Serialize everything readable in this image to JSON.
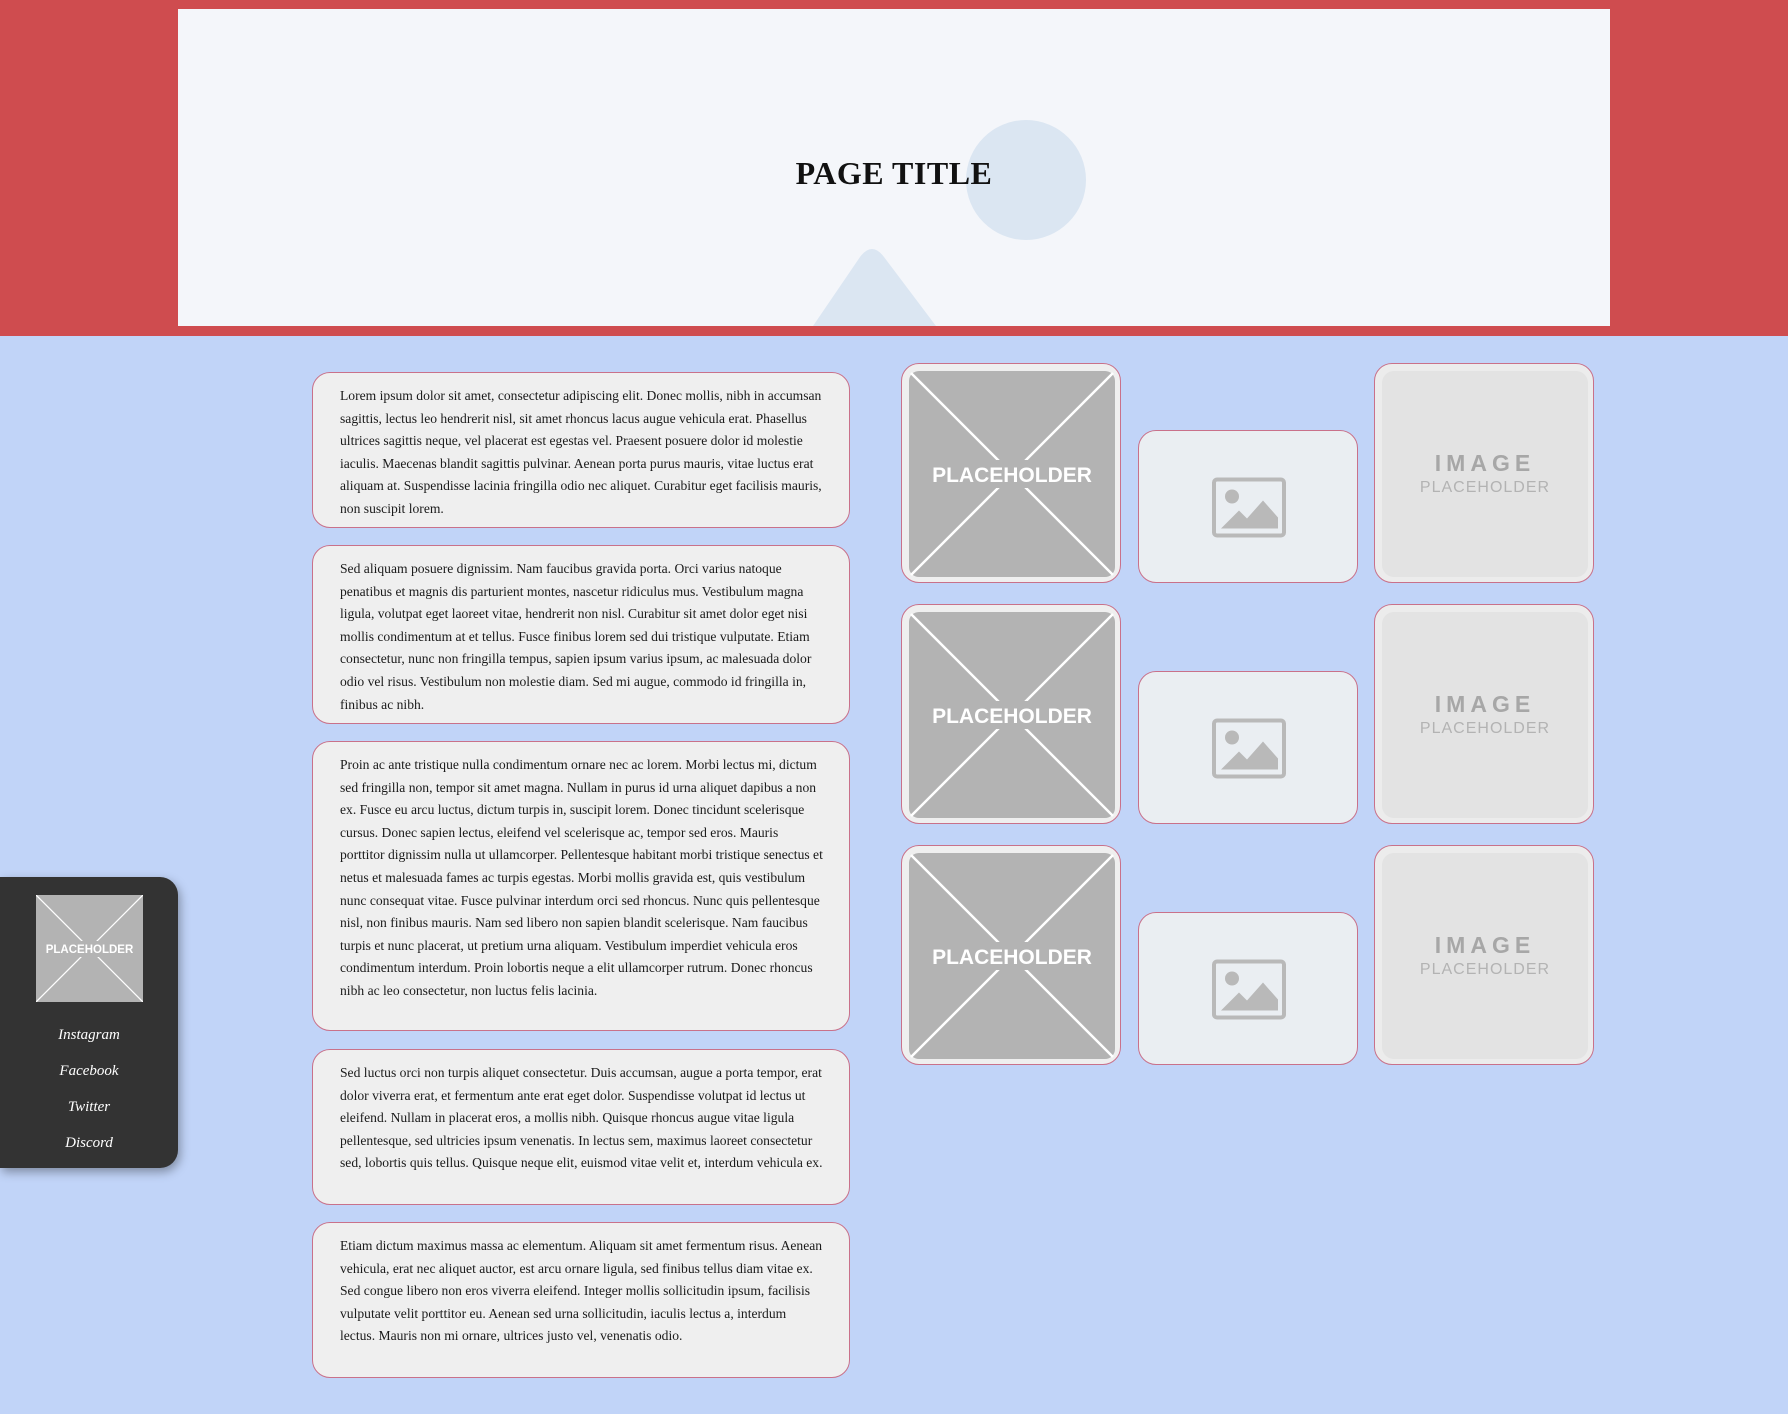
{
  "header": {
    "title": "PAGE TITLE",
    "colors": {
      "band": "#cf4c4f",
      "card": "#f4f6fa",
      "decor": "#dbe6f2"
    }
  },
  "sidebar": {
    "avatar_label": "PLACEHOLDER",
    "links": [
      {
        "label": "Instagram"
      },
      {
        "label": "Facebook"
      },
      {
        "label": "Twitter"
      },
      {
        "label": "Discord"
      }
    ]
  },
  "content": {
    "paragraphs": [
      {
        "text": "Lorem ipsum dolor sit amet, consectetur adipiscing elit. Donec mollis, nibh in accumsan sagittis, lectus leo hendrerit nisl, sit amet rhoncus lacus augue vehicula erat. Phasellus ultrices sagittis neque, vel placerat est egestas vel. Praesent posuere dolor id molestie iaculis. Maecenas blandit sagittis pulvinar. Aenean porta purus mauris, vitae luctus erat aliquam at. Suspendisse lacinia fringilla odio nec aliquet. Curabitur eget facilisis mauris, non suscipit lorem."
      },
      {
        "text": "Sed aliquam posuere dignissim. Nam faucibus gravida porta. Orci varius natoque penatibus et magnis dis parturient montes, nascetur ridiculus mus. Vestibulum magna ligula, volutpat eget laoreet vitae, hendrerit non nisl. Curabitur sit amet dolor eget nisi mollis condimentum at et tellus. Fusce finibus lorem sed dui tristique vulputate. Etiam consectetur, nunc non fringilla tempus, sapien ipsum varius ipsum, ac malesuada dolor odio vel risus. Vestibulum non molestie diam. Sed mi augue, commodo id fringilla in, finibus ac nibh."
      },
      {
        "text": "Proin ac ante tristique nulla condimentum ornare nec ac lorem. Morbi lectus mi, dictum sed fringilla non, tempor sit amet magna. Nullam in purus id urna aliquet dapibus a non ex. Fusce eu arcu luctus, dictum turpis in, suscipit lorem. Donec tincidunt scelerisque cursus. Donec sapien lectus, eleifend vel scelerisque ac, tempor sed eros. Mauris porttitor dignissim nulla ut ullamcorper. Pellentesque habitant morbi tristique senectus et netus et malesuada fames ac turpis egestas. Morbi mollis gravida est, quis vestibulum nunc consequat vitae. Fusce pulvinar interdum orci sed rhoncus. Nunc quis pellentesque nisl, non finibus mauris. Nam sed libero non sapien blandit scelerisque. Nam faucibus turpis et nunc placerat, ut pretium urna aliquam. Vestibulum imperdiet vehicula eros condimentum interdum. Proin lobortis neque a elit ullamcorper rutrum. Donec rhoncus nibh ac leo consectetur, non luctus felis lacinia."
      },
      {
        "text": "Sed luctus orci non turpis aliquet consectetur. Duis accumsan, augue a porta tempor, erat dolor viverra erat, et fermentum ante erat eget dolor. Suspendisse volutpat id lectus ut eleifend. Nullam in placerat eros, a mollis nibh. Quisque rhoncus augue vitae ligula pellentesque, sed ultricies ipsum venenatis. In lectus sem, maximus laoreet consectetur sed, lobortis quis tellus. Quisque neque elit, euismod vitae velit et, interdum vehicula ex."
      },
      {
        "text": "Etiam dictum maximus massa ac elementum. Aliquam sit amet fermentum risus. Aenean vehicula, erat nec aliquet auctor, est arcu ornare ligula, sed finibus tellus diam vitae ex. Sed congue libero non eros viverra eleifend. Integer mollis sollicitudin ipsum, facilisis vulputate velit porttitor eu. Aenean sed urna sollicitudin, iaculis lectus a, interdum lectus. Mauris non mi ornare, ultrices justo vel, venenatis odio."
      }
    ]
  },
  "gallery": {
    "rows": [
      {
        "cards": [
          {
            "kind": "x-placeholder",
            "label": "PLACEHOLDER"
          },
          {
            "kind": "image-icon"
          },
          {
            "kind": "image-placeholder",
            "title": "IMAGE",
            "subtitle": "PLACEHOLDER"
          }
        ]
      },
      {
        "cards": [
          {
            "kind": "x-placeholder",
            "label": "PLACEHOLDER"
          },
          {
            "kind": "image-icon"
          },
          {
            "kind": "image-placeholder",
            "title": "IMAGE",
            "subtitle": "PLACEHOLDER"
          }
        ]
      },
      {
        "cards": [
          {
            "kind": "x-placeholder",
            "label": "PLACEHOLDER"
          },
          {
            "kind": "image-icon"
          },
          {
            "kind": "image-placeholder",
            "title": "IMAGE",
            "subtitle": "PLACEHOLDER"
          }
        ]
      }
    ]
  }
}
